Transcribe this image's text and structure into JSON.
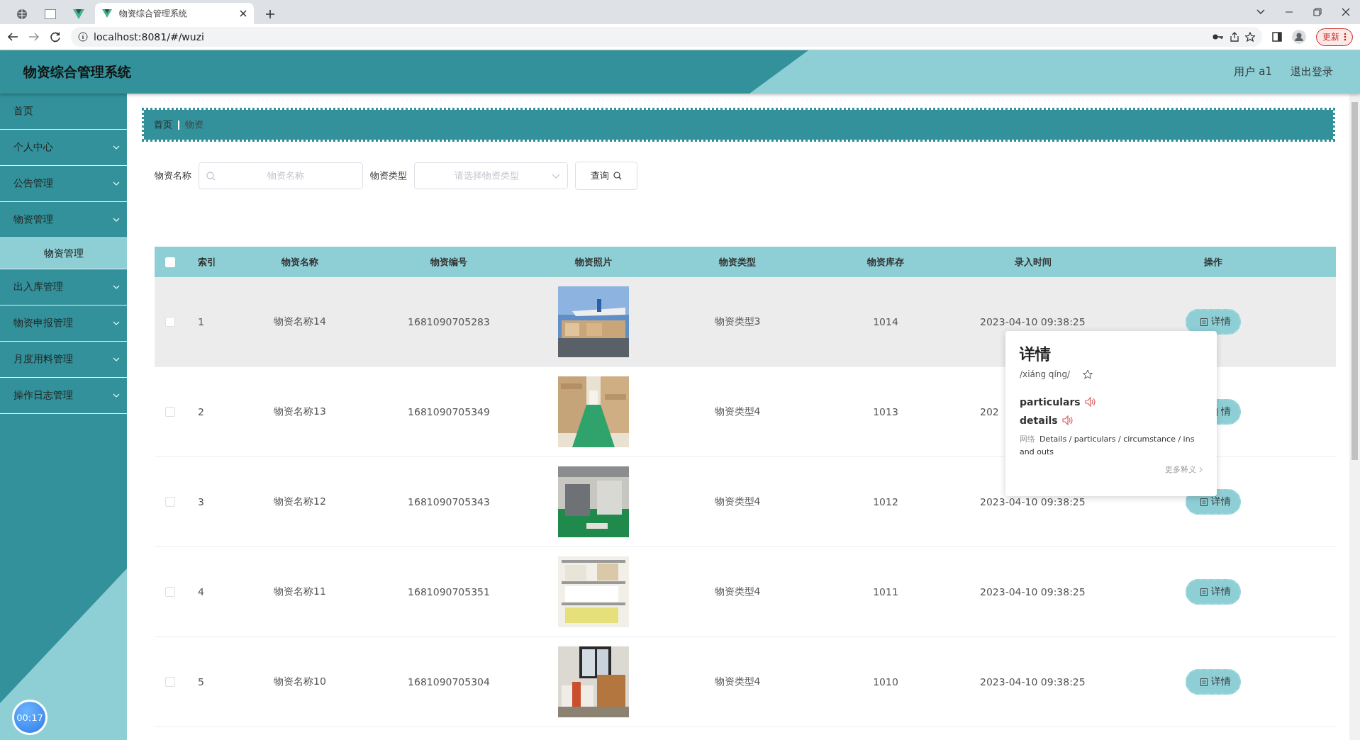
{
  "browser": {
    "tabs": [
      {
        "label": "物资综合管理系统",
        "selected": true
      }
    ],
    "address": "localhost:8081/#/wuzi",
    "update_button": "更新"
  },
  "header": {
    "title": "物资综合管理系统",
    "user": "用户 a1",
    "logout": "退出登录"
  },
  "sidebar": {
    "items": [
      {
        "label": "首页",
        "kind": "link"
      },
      {
        "label": "个人中心",
        "kind": "menu",
        "expanded": false
      },
      {
        "label": "公告管理",
        "kind": "menu",
        "expanded": false
      },
      {
        "label": "物资管理",
        "kind": "menu",
        "expanded": true,
        "children": [
          {
            "label": "物资管理",
            "selected": true
          }
        ]
      },
      {
        "label": "出入库管理",
        "kind": "menu",
        "expanded": false
      },
      {
        "label": "物资申报管理",
        "kind": "menu",
        "expanded": false
      },
      {
        "label": "月度用料管理",
        "kind": "menu",
        "expanded": false
      },
      {
        "label": "操作日志管理",
        "kind": "menu",
        "expanded": false
      }
    ]
  },
  "breadcrumb": [
    "首页",
    "物资"
  ],
  "search": {
    "fields": [
      {
        "label": "物资名称",
        "placeholder": "物资名称",
        "kind": "text"
      },
      {
        "label": "物资类型",
        "placeholder": "请选择物资类型",
        "kind": "select"
      }
    ],
    "button": "查询"
  },
  "table": {
    "select_all": false,
    "columns": [
      "索引",
      "物资名称",
      "物资编号",
      "物资照片",
      "物资类型",
      "物资库存",
      "录入时间",
      "操作"
    ],
    "rows": [
      {
        "checked": false,
        "hovered": true,
        "index": "1",
        "name": "物资名称14",
        "code": "1681090705283",
        "type": "物资类型3",
        "stock": "1014",
        "time": "2023-04-10 09:38:25",
        "action": "详情"
      },
      {
        "checked": false,
        "hovered": false,
        "index": "2",
        "name": "物资名称13",
        "code": "1681090705349",
        "type": "物资类型4",
        "stock": "1013",
        "time": "202",
        "action": "情"
      },
      {
        "checked": false,
        "hovered": false,
        "index": "3",
        "name": "物资名称12",
        "code": "1681090705343",
        "type": "物资类型4",
        "stock": "1012",
        "time": "2023-04-10 09:38:25",
        "action": "详情"
      },
      {
        "checked": false,
        "hovered": false,
        "index": "4",
        "name": "物资名称11",
        "code": "1681090705351",
        "type": "物资类型4",
        "stock": "1011",
        "time": "2023-04-10 09:38:25",
        "action": "详情"
      },
      {
        "checked": false,
        "hovered": false,
        "index": "5",
        "name": "物资名称10",
        "code": "1681090705304",
        "type": "物资类型4",
        "stock": "1010",
        "time": "2023-04-10 09:38:25",
        "action": "详情"
      }
    ]
  },
  "dictionary_popup": {
    "word": "详情",
    "pinyin": "/xiáng qíng/",
    "translations": [
      "particulars",
      "details"
    ],
    "web_label": "网络",
    "web_text": "Details / particulars / circumstance / ins and outs",
    "more": "更多释义"
  },
  "timer": "00:17"
}
